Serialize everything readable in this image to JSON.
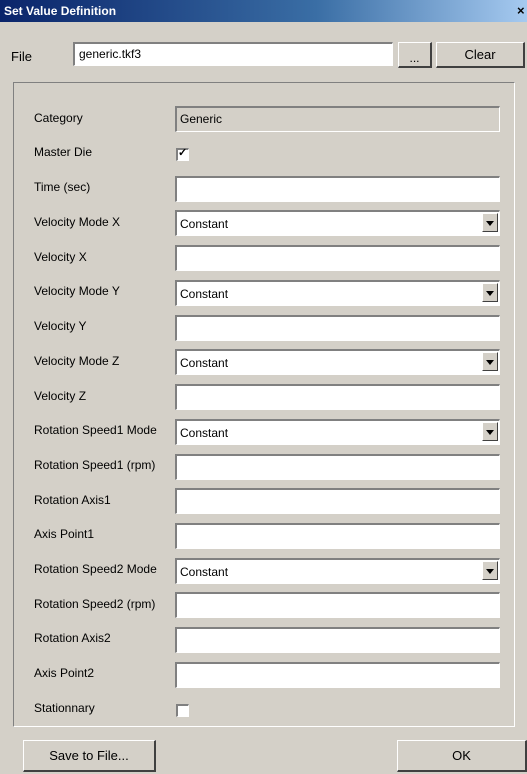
{
  "window": {
    "title": "Set Value Definition"
  },
  "file": {
    "label": "File",
    "value": "generic.tkf3",
    "browse_label": "...",
    "clear_label": "Clear"
  },
  "form": {
    "category": {
      "label": "Category",
      "value": "Generic"
    },
    "master_die": {
      "label": "Master Die",
      "checked": true
    },
    "time": {
      "label": "Time (sec)",
      "value": ""
    },
    "velocity_mode_x": {
      "label": "Velocity Mode X",
      "value": "Constant"
    },
    "velocity_x": {
      "label": "Velocity X",
      "value": ""
    },
    "velocity_mode_y": {
      "label": "Velocity Mode Y",
      "value": "Constant"
    },
    "velocity_y": {
      "label": "Velocity Y",
      "value": ""
    },
    "velocity_mode_z": {
      "label": "Velocity Mode Z",
      "value": "Constant"
    },
    "velocity_z": {
      "label": "Velocity Z",
      "value": ""
    },
    "rotation_speed1_mode": {
      "label": "Rotation Speed1 Mode",
      "value": "Constant"
    },
    "rotation_speed1_rpm": {
      "label": "Rotation Speed1 (rpm)",
      "value": ""
    },
    "rotation_axis1": {
      "label": "Rotation Axis1",
      "value": ""
    },
    "axis_point1": {
      "label": "Axis Point1",
      "value": ""
    },
    "rotation_speed2_mode": {
      "label": "Rotation Speed2 Mode",
      "value": "Constant"
    },
    "rotation_speed2_rpm": {
      "label": "Rotation Speed2 (rpm)",
      "value": ""
    },
    "rotation_axis2": {
      "label": "Rotation Axis2",
      "value": ""
    },
    "axis_point2": {
      "label": "Axis Point2",
      "value": ""
    },
    "stationnary": {
      "label": "Stationnary",
      "checked": false
    }
  },
  "footer": {
    "save_label": "Save to File...",
    "ok_label": "OK"
  }
}
